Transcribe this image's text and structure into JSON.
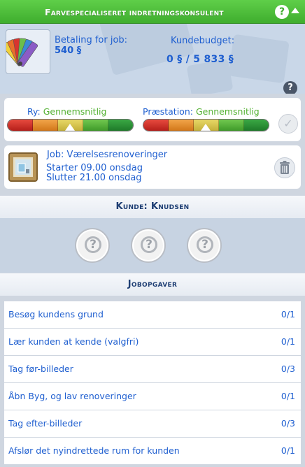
{
  "header": {
    "title": "Farvespecialiseret indretningskonsulent",
    "help": "?"
  },
  "payment": {
    "label": "Betaling for job:",
    "value": "540 §"
  },
  "budget": {
    "label": "Kundebudget:",
    "value": "0 § / 5 833 §"
  },
  "help_small": "?",
  "ratings": {
    "reputation": {
      "key": "Ry:",
      "value": "Gennemsnitlig",
      "level": 0.5
    },
    "performance": {
      "key": "Præstation:",
      "value": "Gennemsnitlig",
      "level": 0.5
    }
  },
  "job": {
    "title": "Job: Værelsesrenoveringer",
    "start": "Starter 09.00 onsdag",
    "end": "Slutter 21.00 onsdag"
  },
  "client": {
    "header": "Kunde: Knudsen",
    "unknowns": [
      "?",
      "?",
      "?"
    ]
  },
  "tasks": {
    "header": "Jobopgaver",
    "items": [
      {
        "label": "Besøg kundens grund",
        "count": "0/1"
      },
      {
        "label": "Lær kunden at kende (valgfri)",
        "count": "0/1"
      },
      {
        "label": "Tag før-billeder",
        "count": "0/3"
      },
      {
        "label": "Åbn Byg, og lav renoveringer",
        "count": "0/1"
      },
      {
        "label": "Tag efter-billeder",
        "count": "0/3"
      },
      {
        "label": "Afslør det nyindrettede rum for kunden",
        "count": "0/1"
      }
    ]
  },
  "colors": {
    "header_green": "#4cbf3a",
    "text_blue": "#1f5fd0",
    "status_green": "#53b132"
  }
}
